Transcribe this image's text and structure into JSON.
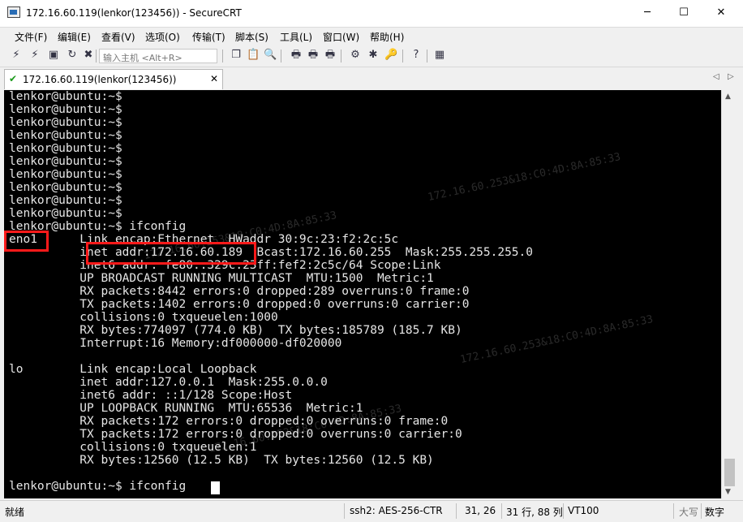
{
  "window": {
    "title": "172.16.60.119(lenkor(123456)) - SecureCRT",
    "controls": {
      "minimize": "─",
      "maximize": "☐",
      "close": "✕"
    }
  },
  "menu": [
    "文件(F)",
    "编辑(E)",
    "查看(V)",
    "选项(O)",
    "传输(T)",
    "脚本(S)",
    "工具(L)",
    "窗口(W)",
    "帮助(H)"
  ],
  "toolbar": {
    "quick_connect_placeholder": "输入主机 <Alt+R>"
  },
  "tab": {
    "label": "172.16.60.119(lenkor(123456))",
    "close": "✕",
    "nav_left": "◁",
    "nav_right": "▷"
  },
  "terminal": {
    "lines": [
      "lenkor@ubuntu:~$",
      "lenkor@ubuntu:~$",
      "lenkor@ubuntu:~$",
      "lenkor@ubuntu:~$",
      "lenkor@ubuntu:~$",
      "lenkor@ubuntu:~$",
      "lenkor@ubuntu:~$",
      "lenkor@ubuntu:~$",
      "lenkor@ubuntu:~$",
      "lenkor@ubuntu:~$",
      "lenkor@ubuntu:~$ ifconfig",
      "eno1      Link encap:Ethernet  HWaddr 30:9c:23:f2:2c:5c",
      "          inet addr:172.16.60.189  Bcast:172.16.60.255  Mask:255.255.255.0",
      "          inet6 addr: fe80::329c:23ff:fef2:2c5c/64 Scope:Link",
      "          UP BROADCAST RUNNING MULTICAST  MTU:1500  Metric:1",
      "          RX packets:8442 errors:0 dropped:289 overruns:0 frame:0",
      "          TX packets:1402 errors:0 dropped:0 overruns:0 carrier:0",
      "          collisions:0 txqueuelen:1000",
      "          RX bytes:774097 (774.0 KB)  TX bytes:185789 (185.7 KB)",
      "          Interrupt:16 Memory:df000000-df020000",
      "",
      "lo        Link encap:Local Loopback",
      "          inet addr:127.0.0.1  Mask:255.0.0.0",
      "          inet6 addr: ::1/128 Scope:Host",
      "          UP LOOPBACK RUNNING  MTU:65536  Metric:1",
      "          RX packets:172 errors:0 dropped:0 overruns:0 frame:0",
      "          TX packets:172 errors:0 dropped:0 overruns:0 carrier:0",
      "          collisions:0 txqueuelen:1",
      "          RX bytes:12560 (12.5 KB)  TX bytes:12560 (12.5 KB)",
      "",
      "lenkor@ubuntu:~$ ifconfig"
    ],
    "watermarks": [
      "172.16.60.253&18:C0:4D:8A:85:33",
      "172.16.60.253&18:C0:4D:8A:85:33",
      "172.16.60.253&18:C0:4D:8A:85:33",
      "172.16.60.253&18:C0:4D:8A:85:33"
    ]
  },
  "status": {
    "ready": "就绪",
    "connection": "ssh2: AES-256-CTR",
    "cursor_pos": "31,  26",
    "size": "31 行, 88 列",
    "emulation": "VT100",
    "caps": "大写",
    "num": "数字"
  }
}
